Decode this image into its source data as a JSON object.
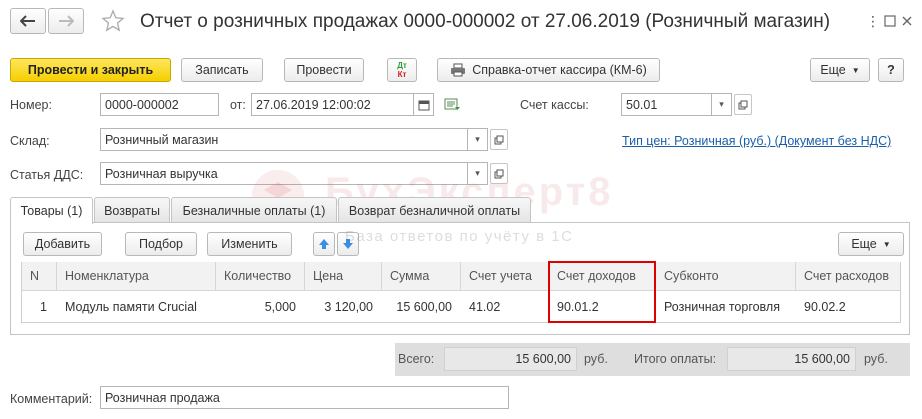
{
  "window": {
    "title": "Отчет о розничных продажах 0000-000002 от 27.06.2019 (Розничный магазин)"
  },
  "toolbar": {
    "post_close_label": "Провести и закрыть",
    "write_label": "Записать",
    "post_label": "Провести",
    "dtkt_top": "Дт",
    "dtkt_bottom": "Кт",
    "cashier_report_label": "Справка-отчет кассира (КМ-6)",
    "more_label": "Еще",
    "help_label": "?"
  },
  "form": {
    "number_label": "Номер:",
    "number_value": "0000-000002",
    "date_label": "от:",
    "date_value": "27.06.2019 12:00:02",
    "cash_account_label": "Счет кассы:",
    "cash_account_value": "50.01",
    "warehouse_label": "Склад:",
    "warehouse_value": "Розничный магазин",
    "price_type_link": "Тип цен: Розничная (руб.) (Документ без НДС)",
    "dds_label": "Статья ДДС:",
    "dds_value": "Розничная выручка"
  },
  "tabs": [
    {
      "label": "Товары (1)",
      "active": true
    },
    {
      "label": "Возвраты",
      "active": false
    },
    {
      "label": "Безналичные оплаты (1)",
      "active": false
    },
    {
      "label": "Возврат безналичной оплаты",
      "active": false
    }
  ],
  "table_toolbar": {
    "add_label": "Добавить",
    "select_label": "Подбор",
    "change_label": "Изменить",
    "more_label": "Еще"
  },
  "table": {
    "columns": [
      "N",
      "Номенклатура",
      "Количество",
      "Цена",
      "Сумма",
      "Счет учета",
      "Счет доходов",
      "Субконто",
      "Счет расходов"
    ],
    "rows": [
      [
        "1",
        "Модуль памяти Crucial",
        "5,000",
        "3 120,00",
        "15 600,00",
        "41.02",
        "90.01.2",
        "Розничная торговля",
        "90.02.2"
      ]
    ],
    "highlighted_column": "Счет доходов"
  },
  "totals": {
    "total_label": "Всего:",
    "total_value": "15 600,00",
    "total_currency": "руб.",
    "paid_label": "Итого оплаты:",
    "paid_value": "15 600,00",
    "paid_currency": "руб."
  },
  "comment": {
    "label": "Комментарий:",
    "value": "Розничная продажа"
  },
  "watermark": {
    "title": "БухЭксперт8",
    "subtitle": "База ответов по учёту в 1С"
  },
  "colors": {
    "primary_button": "#f5cf00",
    "link": "#1a5fa8",
    "highlight_border": "#e00000",
    "arrow_blue": "#3a8ee6",
    "dtkt_green": "#2e9e3e",
    "dtkt_red": "#d02020"
  }
}
